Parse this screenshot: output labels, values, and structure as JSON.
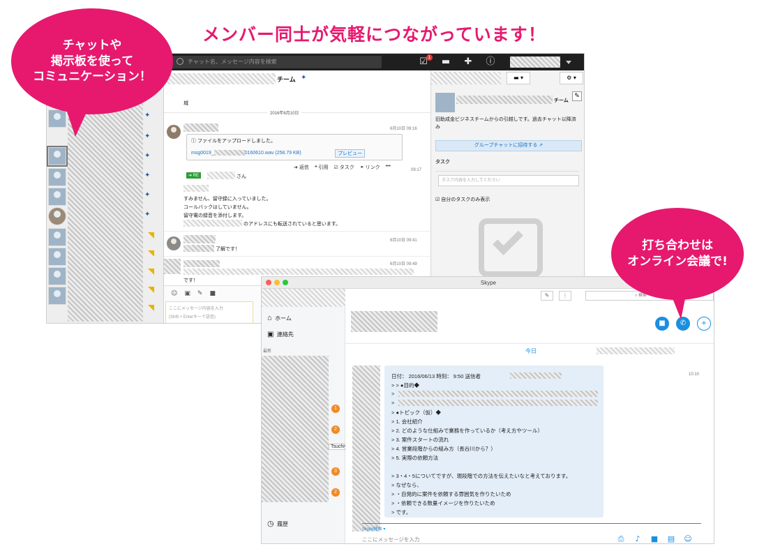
{
  "headline": "メンバー同士が気軽につながっています！",
  "bubble_left": {
    "lines": [
      "チャットや",
      "掲示板を使って",
      "コミュニケーション！"
    ],
    "color": "#e6196e"
  },
  "bubble_right": {
    "lines": [
      "打ち合わせは",
      "オンライン会議で!"
    ],
    "color": "#e6196e"
  },
  "chatwork": {
    "search_placeholder": "チャット名、メッセージ内容を検索",
    "task_badge": "1",
    "room_title": "チーム",
    "date_divider": "2016年6月10日",
    "messages": [
      {
        "text": "城"
      },
      {
        "time": "6月10日 09:16",
        "file_label": "ファイルをアップロードしました。",
        "file_name": "msg0019_",
        "file_suffix": "0160610.wav (258.79 KB)",
        "preview": "プレビュー"
      },
      {
        "time": "09:17",
        "re_tag": "RE",
        "addressee": "さん",
        "lines": [
          "すみません、留守録に入っていました。",
          "コールバックはしていません。",
          "留守電の録音を添付します。",
          "のアドレスにも転送されていると思います。"
        ]
      },
      {
        "time": "6月10日 09:41",
        "text": "了解です！"
      },
      {
        "time": "6月10日 09:49",
        "text": "です！"
      }
    ],
    "actions": [
      "返信",
      "引用",
      "タスク",
      "リンク",
      "•••"
    ],
    "input_placeholder": "ここにメッセージ内容を入力",
    "input_hint": "(Shift + Enterキーで送信)",
    "right_panel": {
      "title": "チーム",
      "description": "旧助成金ビジネスチームからの引越しです。過去チャット以降済み",
      "invite_button": "グループチャットに招待する",
      "task_heading": "タスク",
      "task_placeholder": "タスク内容を入力してください",
      "my_tasks_checkbox": "自分のタスクのみ表示"
    }
  },
  "skype": {
    "window_title": "Skype",
    "search_placeholder": "検索",
    "nav": [
      {
        "icon": "home-icon",
        "label": "ホーム"
      },
      {
        "icon": "contacts-icon",
        "label": "連絡先"
      }
    ],
    "recent_label": "最新",
    "history_label": "履歴",
    "hover_name": "Tsuchiya",
    "unread_badges": [
      "1",
      "2",
      "3",
      "2"
    ],
    "day_divider": "今日",
    "message_time": "10:10",
    "message_lines": [
      "日付： 2016/06/13 時刻： 9:50 送信者",
      "> > ●目的◆",
      ">",
      ">",
      "> ●トピック（仮）◆",
      "> 1. 会社紹介",
      "> 2. どのような仕組みで業務を作っているか（考え方やツール）",
      "> 3. 案件スタートの流れ",
      "> 4. 営業段階からの組み方（長谷川から？）",
      "> 5. 実際の依頼方法",
      "",
      "> 3・4・5についてですが、現段階での方法を伝えたいなと考えております。",
      "> なぜなら、",
      "> ・自発的に案件を依頼する雰囲気を作りたいため",
      "> ・依頼できる数量イメージを作りたいため",
      "> です。"
    ],
    "compose_label": "Skype経由",
    "compose_placeholder": "ここにメッセージを入力",
    "accent": "#1a8fe0"
  }
}
